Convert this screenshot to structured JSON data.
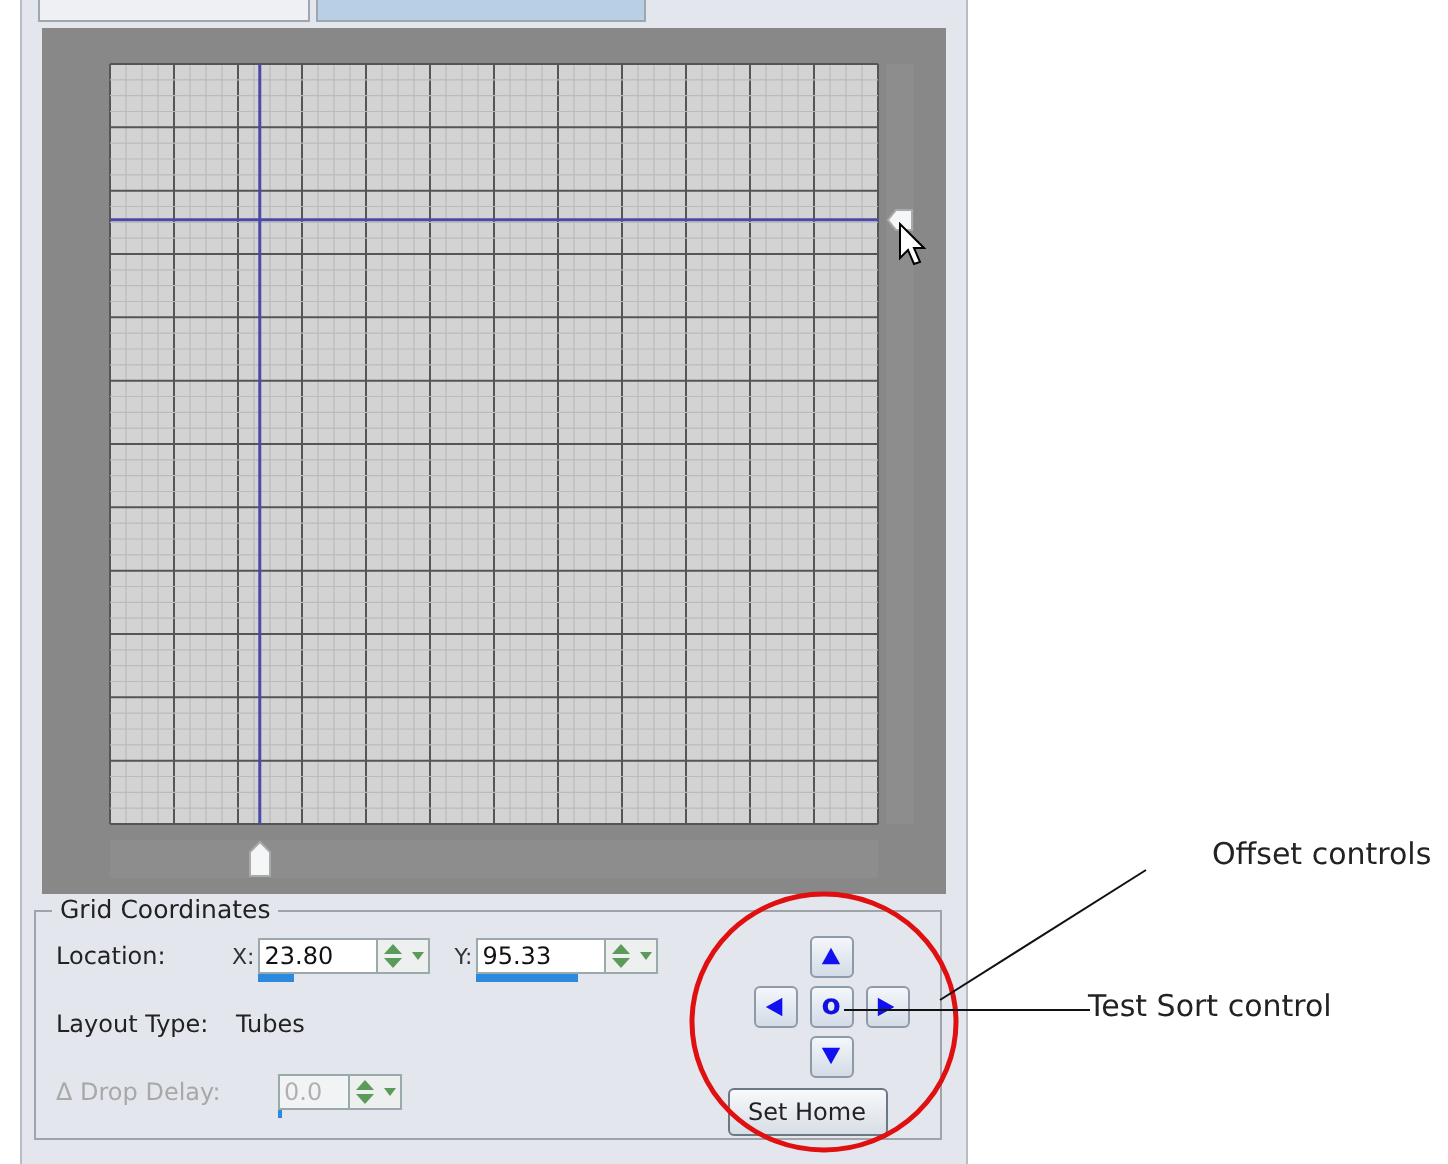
{
  "tabs": [
    {
      "selected": false
    },
    {
      "selected": true
    }
  ],
  "canvas": {
    "x_slider": {
      "level": 0.195
    },
    "y_slider": {
      "level": 0.795
    }
  },
  "group": {
    "title": "Grid Coordinates",
    "location": {
      "label": "Location:",
      "fields": [
        {
          "label": "X:",
          "value": "23.80",
          "level": 0.3
        },
        {
          "label": "Y:",
          "value": "95.33",
          "level": 0.78
        }
      ]
    },
    "layout_type": {
      "label": "Layout Type:",
      "value": "Tubes"
    },
    "drop_delay": {
      "label": "Δ Drop Delay:",
      "value": "0.0",
      "disabled": true,
      "level": 0.05
    },
    "nav": {
      "center": "o",
      "set_home": "Set Home"
    }
  },
  "callouts": [
    {
      "kind": "offset",
      "text": "Offset controls"
    },
    {
      "kind": "test",
      "text": "Test Sort control"
    }
  ]
}
